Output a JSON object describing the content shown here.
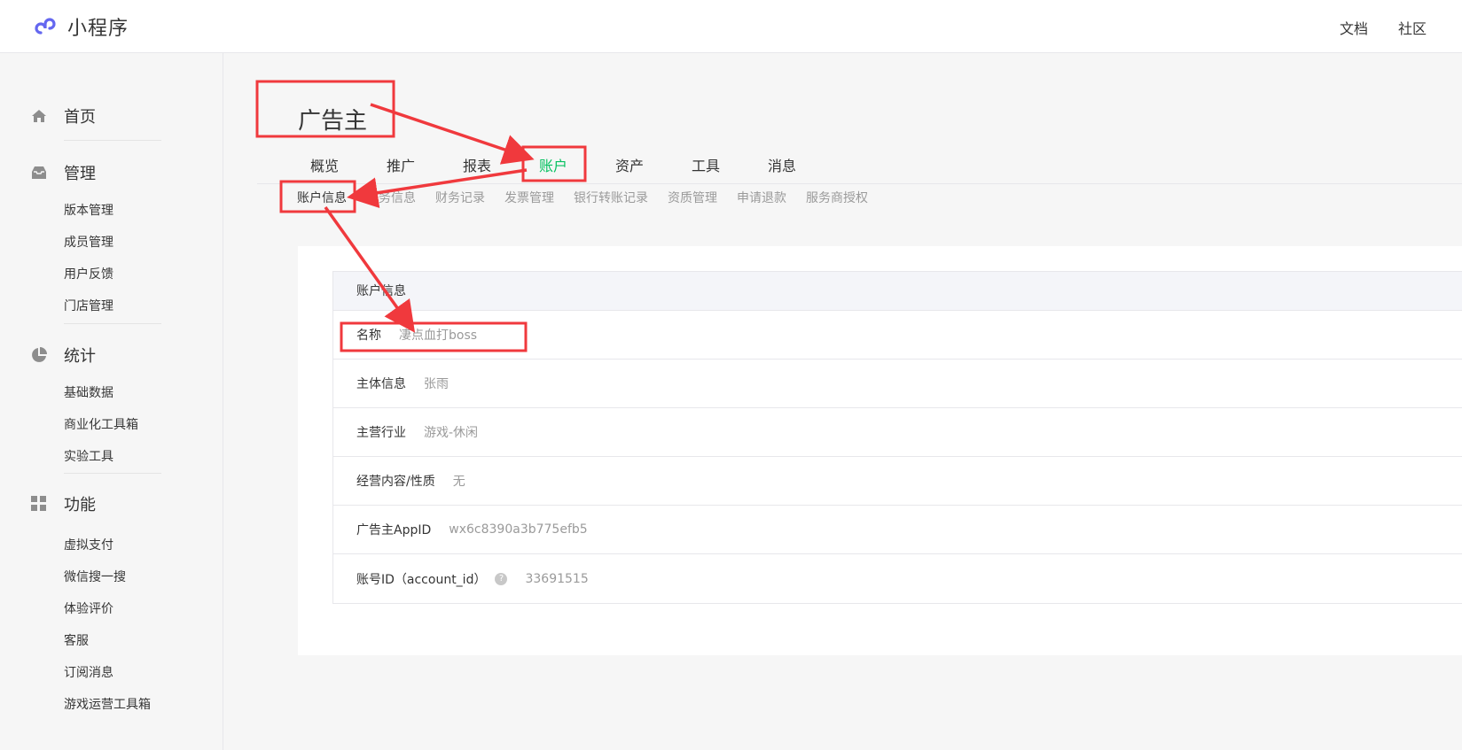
{
  "header": {
    "logo_text": "小程序",
    "links": [
      "文档",
      "社区"
    ]
  },
  "sidebar": {
    "groups": [
      {
        "title": "首页",
        "icon": "home-icon",
        "items": []
      },
      {
        "title": "管理",
        "icon": "inbox-icon",
        "items": [
          "版本管理",
          "成员管理",
          "用户反馈",
          "门店管理"
        ]
      },
      {
        "title": "统计",
        "icon": "pie-chart-icon",
        "items": [
          "基础数据",
          "商业化工具箱",
          "实验工具"
        ]
      },
      {
        "title": "功能",
        "icon": "grid-icon",
        "items": [
          "虚拟支付",
          "微信搜一搜",
          "体验评价",
          "客服",
          "订阅消息",
          "游戏运营工具箱"
        ]
      }
    ]
  },
  "main": {
    "title": "广告主",
    "tabs": [
      "概览",
      "推广",
      "报表",
      "账户",
      "资产",
      "工具",
      "消息"
    ],
    "active_tab": "账户",
    "subtabs": [
      "账户信息",
      "财务信息",
      "财务记录",
      "发票管理",
      "银行转账记录",
      "资质管理",
      "申请退款",
      "服务商授权"
    ],
    "active_subtab": "账户信息",
    "info": {
      "header": "账户信息",
      "rows": [
        {
          "label": "名称",
          "value": "凄点血打boss"
        },
        {
          "label": "主体信息",
          "value": "张雨"
        },
        {
          "label": "主营行业",
          "value": "游戏-休闲"
        },
        {
          "label": "经营内容/性质",
          "value": "无"
        },
        {
          "label": "广告主AppID",
          "value": "wx6c8390a3b775efb5"
        },
        {
          "label": "账号ID（account_id）",
          "value": "33691515",
          "help_icon": "?"
        }
      ]
    }
  },
  "colors": {
    "accent": "#07c160",
    "annotation": "#f0393d"
  }
}
